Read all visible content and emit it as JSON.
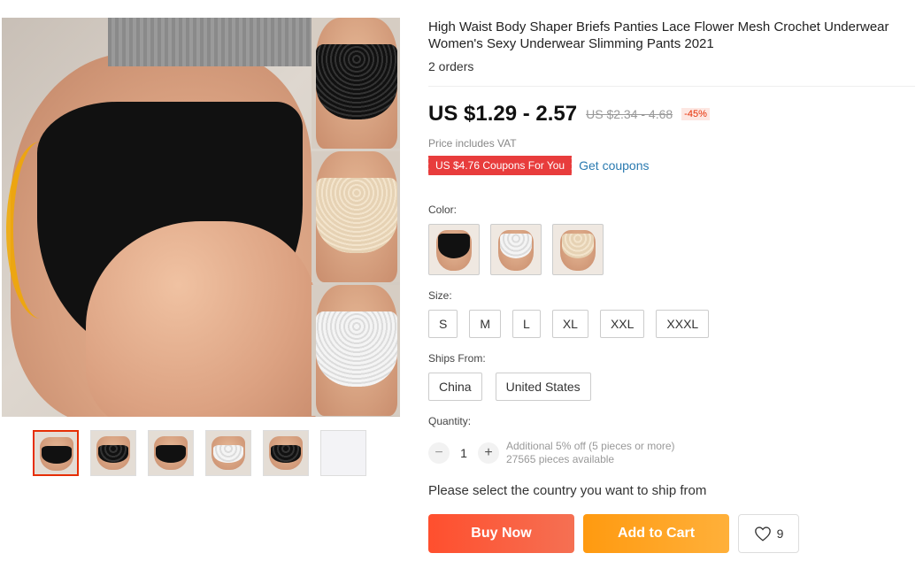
{
  "product": {
    "title": "High Waist Body Shaper Briefs Panties Lace Flower Mesh Crochet Underwear Women's Sexy Underwear Slimming Pants 2021",
    "orders": "2 orders",
    "price": "US $1.29 - 2.57",
    "original_price": "US $2.34 - 4.68",
    "discount": "-45%",
    "vat_note": "Price includes VAT",
    "coupon_badge": "US $4.76 Coupons For You",
    "get_coupons": "Get coupons"
  },
  "gallery": {
    "thumbnail_count": 6,
    "active_index": 0,
    "colors": {
      "accent_border": "#e62e04"
    }
  },
  "color": {
    "label": "Color:",
    "options": [
      "black",
      "white",
      "beige"
    ]
  },
  "size": {
    "label": "Size:",
    "options": [
      "S",
      "M",
      "L",
      "XL",
      "XXL",
      "XXXL"
    ]
  },
  "ships_from": {
    "label": "Ships From:",
    "options": [
      "China",
      "United States"
    ]
  },
  "quantity": {
    "label": "Quantity:",
    "minus": "−",
    "value": "1",
    "plus": "+",
    "bulk_note": "Additional 5% off (5 pieces or more)",
    "available": "27565 pieces available"
  },
  "ship_message": "Please select the country you want to ship from",
  "actions": {
    "buy_now": "Buy Now",
    "add_to_cart": "Add to Cart",
    "wishlist_count": "9",
    "buy_color": "#ff4f2e",
    "cart_color": "#ff9a10"
  }
}
